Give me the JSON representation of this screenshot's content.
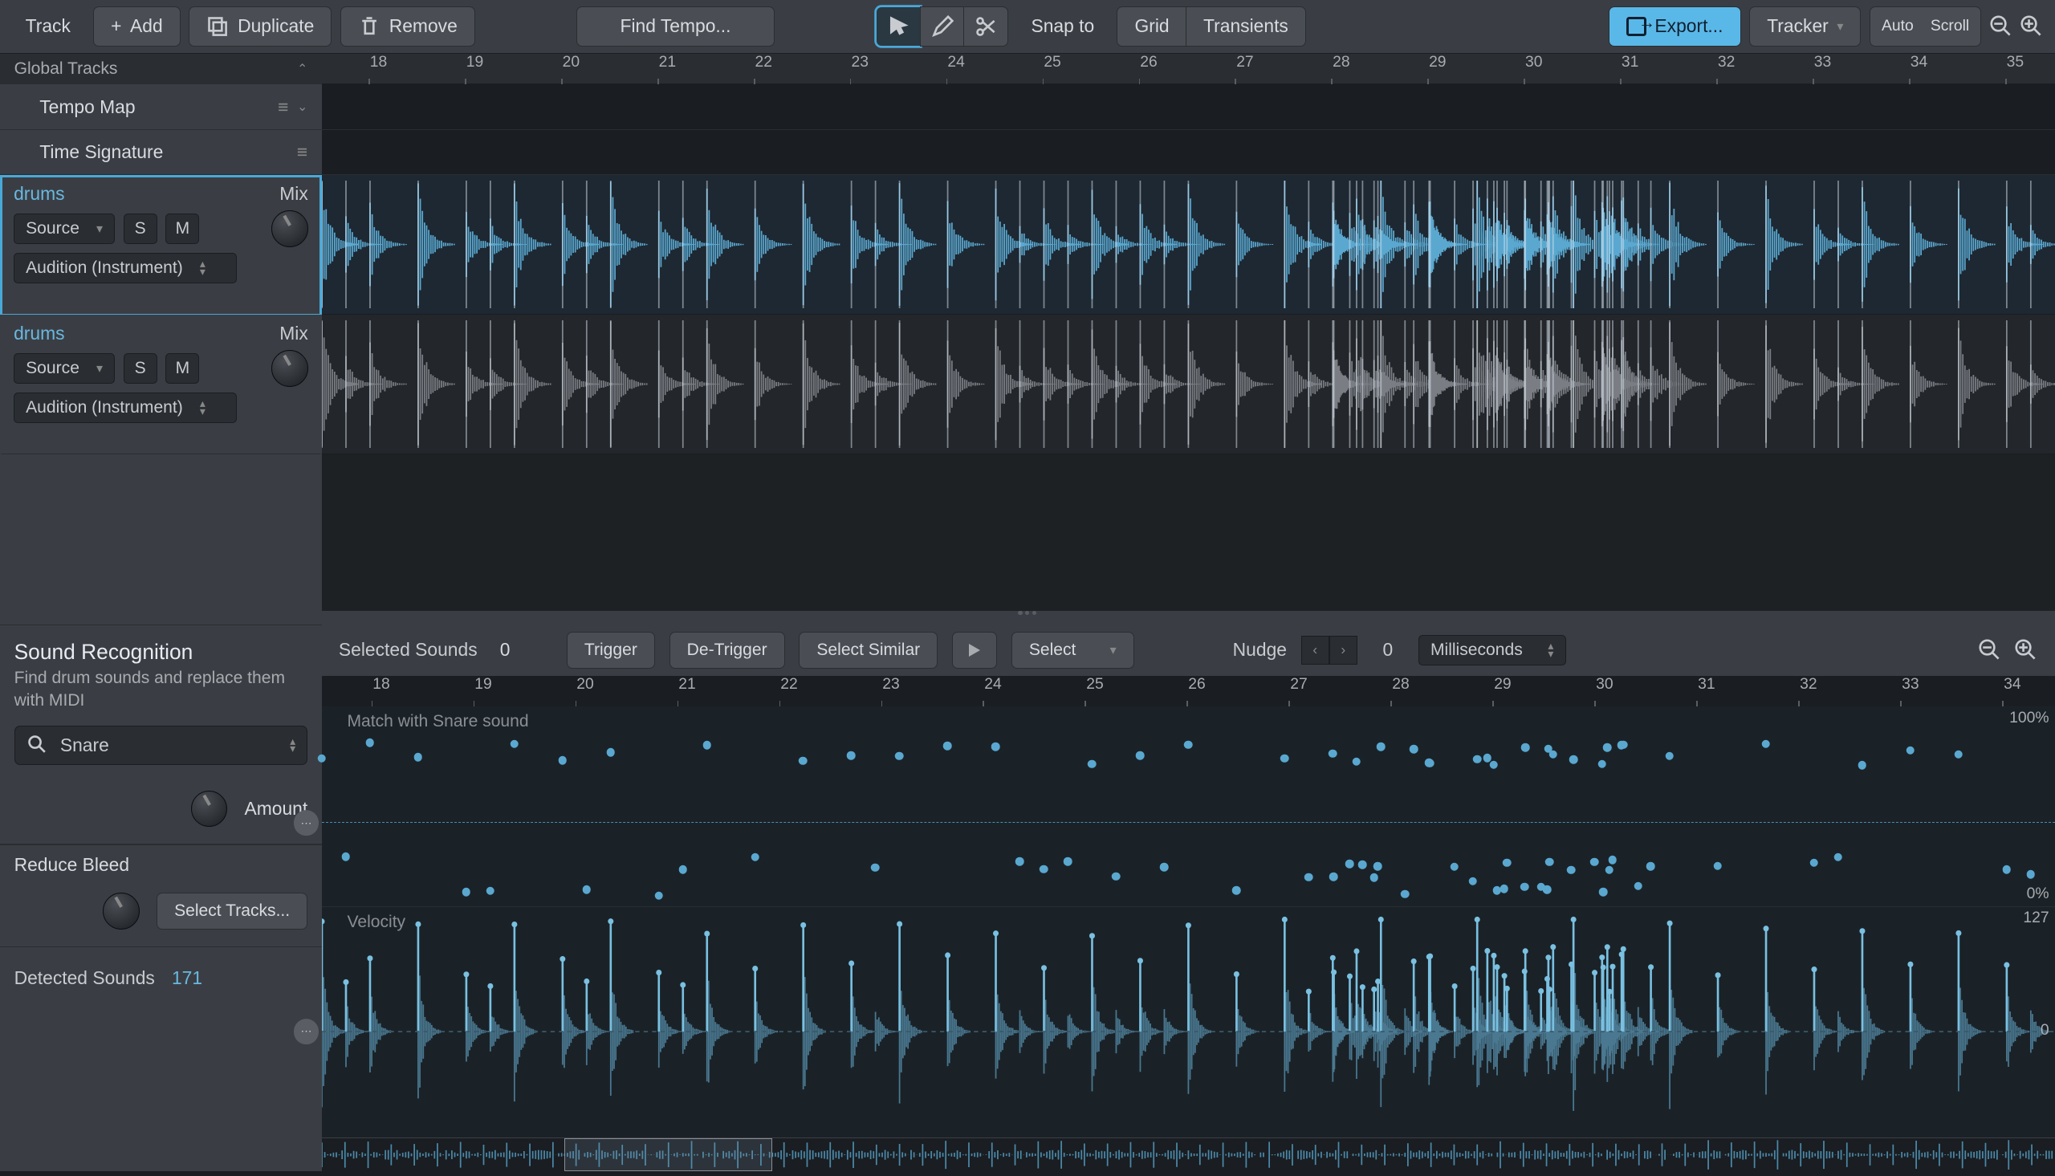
{
  "toolbar": {
    "track": "Track",
    "add": "Add",
    "duplicate": "Duplicate",
    "remove": "Remove",
    "find_tempo": "Find Tempo...",
    "snap_to": "Snap to",
    "grid": "Grid",
    "transients": "Transients",
    "export": "Export...",
    "tracker": "Tracker",
    "auto_scroll_l1": "Auto",
    "auto_scroll_l2": "Scroll"
  },
  "global": {
    "header": "Global Tracks",
    "tempo_map": "Tempo Map",
    "time_sig": "Time Signature"
  },
  "tracks": [
    {
      "name": "drums",
      "mix": "Mix",
      "source": "Source",
      "s": "S",
      "m": "M",
      "audition": "Audition (Instrument)"
    },
    {
      "name": "drums",
      "mix": "Mix",
      "source": "Source",
      "s": "S",
      "m": "M",
      "audition": "Audition (Instrument)"
    }
  ],
  "ruler_ticks": [
    18,
    19,
    20,
    21,
    22,
    23,
    24,
    25,
    26,
    27,
    28,
    29,
    30,
    31,
    32,
    33,
    34,
    35
  ],
  "lower_ruler_ticks": [
    18,
    19,
    20,
    21,
    22,
    23,
    24,
    25,
    26,
    27,
    28,
    29,
    30,
    31,
    32,
    33,
    34
  ],
  "sr": {
    "title": "Sound Recognition",
    "sub": "Find drum sounds and replace them with MIDI",
    "drum": "Snare",
    "amount": "Amount",
    "reduce_bleed": "Reduce Bleed",
    "select_tracks": "Select Tracks...",
    "detected_label": "Detected Sounds",
    "detected_count": "171"
  },
  "lower": {
    "selected_label": "Selected Sounds",
    "selected_count": "0",
    "trigger": "Trigger",
    "detrigger": "De-Trigger",
    "select_similar": "Select Similar",
    "select": "Select",
    "nudge": "Nudge",
    "nudge_val": "0",
    "units": "Milliseconds",
    "match_label": "Match with Snare sound",
    "scale_100": "100%",
    "scale_0": "0%",
    "vel_label": "Velocity",
    "vel_127": "127",
    "vel_0": "0"
  },
  "colors": {
    "wave_active": "#5aa8d0",
    "wave_inactive": "#7a7e84",
    "accent": "#4aa8d8"
  }
}
